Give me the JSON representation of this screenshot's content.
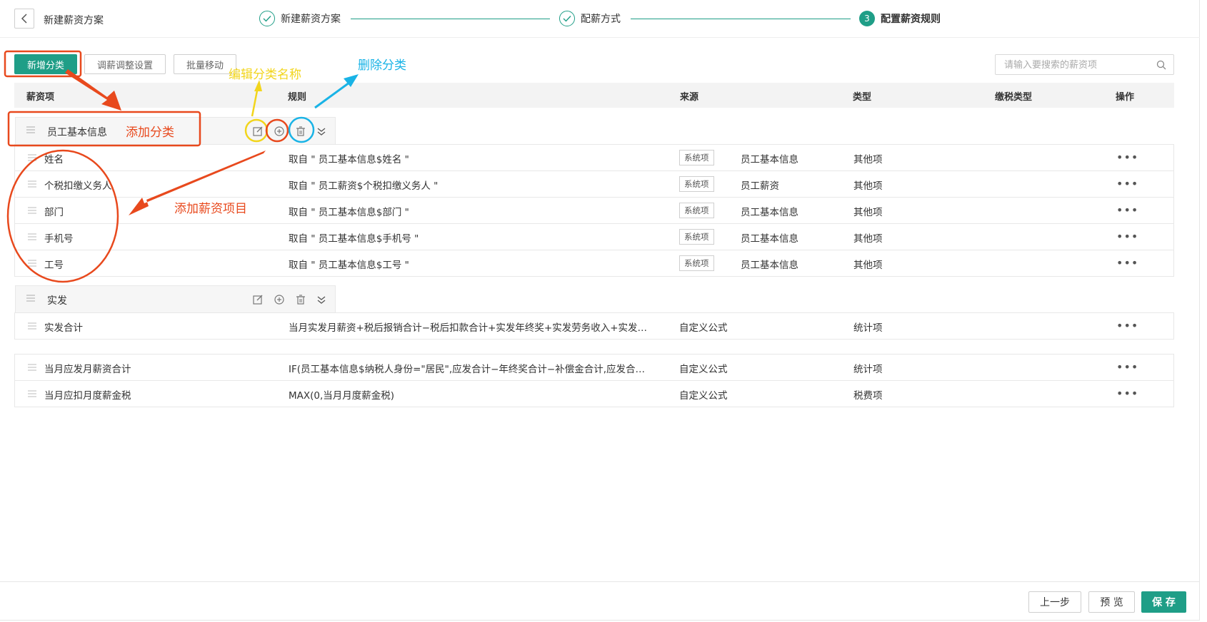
{
  "header": {
    "back_icon": "chevron-left-icon",
    "title": "新建薪资方案",
    "steps": [
      {
        "label": "新建薪资方案",
        "status": "done"
      },
      {
        "label": "配薪方式",
        "status": "done"
      },
      {
        "label": "配置薪资规则",
        "status": "active",
        "number": "3"
      }
    ]
  },
  "toolbar": {
    "add_category_label": "新增分类",
    "adjust_settings_label": "调薪调整设置",
    "batch_move_label": "批量移动",
    "search_placeholder": "请输入要搜索的薪资项"
  },
  "table": {
    "headers": [
      "薪资项",
      "规则",
      "来源",
      "类型",
      "缴税类型",
      "操作"
    ],
    "groups": [
      {
        "name": "员工基本信息",
        "rows": [
          {
            "name": "姓名",
            "rule": "取自 \" 员工基本信息$姓名 \"",
            "tag": "系统项",
            "source": "员工基本信息",
            "type": "其他项",
            "ops": "•••"
          },
          {
            "name": "个税扣缴义务人",
            "rule": "取自 \" 员工薪资$个税扣缴义务人 \"",
            "tag": "系统项",
            "source": "员工薪资",
            "type": "其他项",
            "ops": "•••"
          },
          {
            "name": "部门",
            "rule": "取自 \" 员工基本信息$部门 \"",
            "tag": "系统项",
            "source": "员工基本信息",
            "type": "其他项",
            "ops": "•••"
          },
          {
            "name": "手机号",
            "rule": "取自 \" 员工基本信息$手机号 \"",
            "tag": "系统项",
            "source": "员工基本信息",
            "type": "其他项",
            "ops": "•••"
          },
          {
            "name": "工号",
            "rule": "取自 \" 员工基本信息$工号 \"",
            "tag": "系统项",
            "source": "员工基本信息",
            "type": "其他项",
            "ops": "•••"
          }
        ]
      },
      {
        "name": "实发",
        "rows": [
          {
            "name": "实发合计",
            "rule": "当月实发月薪资+税后报销合计−税后扣款合计+实发年终奖+实发劳务收入+实发…",
            "source": "自定义公式",
            "type": "统计项",
            "ops": "•••"
          }
        ]
      }
    ],
    "ungrouped_rows": [
      {
        "name": "当月应发月薪资合计",
        "rule": "IF(员工基本信息$纳税人身份=\"居民\",应发合计−年终奖合计−补偿金合计,应发合…",
        "source": "自定义公式",
        "type": "统计项",
        "ops": "•••"
      },
      {
        "name": "当月应扣月度薪金税",
        "rule": "MAX(0,当月月度薪金税)",
        "source": "自定义公式",
        "type": "税费项",
        "ops": "•••"
      }
    ]
  },
  "annotations": {
    "edit_category_name": "编辑分类名称",
    "delete_category": "删除分类",
    "add_category": "添加分类",
    "add_salary_item": "添加薪资项目"
  },
  "footer": {
    "prev_label": "上一步",
    "preview_label": "预 览",
    "save_label": "保 存"
  },
  "colors": {
    "accent": "#1f9e87",
    "annotation_red": "#e8491d",
    "annotation_yellow": "#f2d51c",
    "annotation_blue": "#19b3e6"
  }
}
